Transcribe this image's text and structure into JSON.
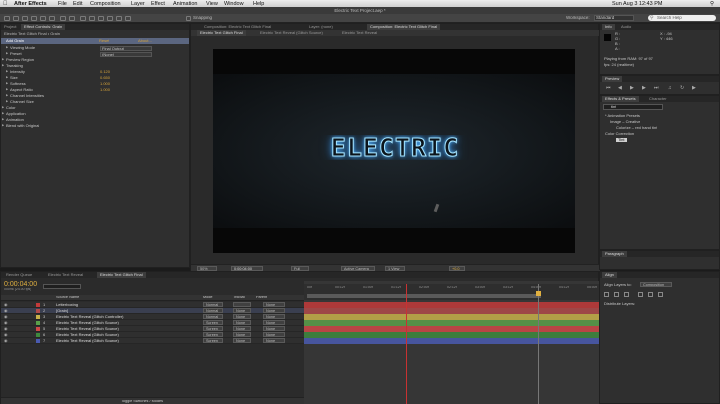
{
  "menubar": {
    "app": "After Effects",
    "items": [
      "File",
      "Edit",
      "Composition",
      "Layer",
      "Effect",
      "Animation",
      "View",
      "Window",
      "Help"
    ],
    "clock": "Sun Aug 3  12:43 PM"
  },
  "window_title": "Electric Text Project.aep *",
  "toolbar": {
    "snapping": "Snapping",
    "workspace_label": "Workspace:",
    "workspace_value": "Standard",
    "search_help": "Search Help"
  },
  "left_panel": {
    "tabs": [
      "Project",
      "Effect Controls: Grain"
    ],
    "header": "Electric Text Glitch Final • Grain",
    "effect_name": "Add Grain",
    "reset": "Reset",
    "about": "About...",
    "rows": [
      {
        "label": "Viewing Mode",
        "value": "Final Output"
      },
      {
        "label": "Preset",
        "value": "(None)"
      },
      {
        "label": "Preview Region",
        "value": ""
      },
      {
        "label": "Tweaking",
        "value": ""
      },
      {
        "label": "Intensity",
        "value": "0.120"
      },
      {
        "label": "Size",
        "value": "0.650"
      },
      {
        "label": "Softness",
        "value": "1.000"
      },
      {
        "label": "Aspect Ratio",
        "value": "1.000"
      },
      {
        "label": "Channel Intensities",
        "value": ""
      },
      {
        "label": "Channel Size",
        "value": ""
      },
      {
        "label": "Color",
        "value": ""
      },
      {
        "label": "Application",
        "value": ""
      },
      {
        "label": "Animation",
        "value": ""
      },
      {
        "label": "Blend with Original",
        "value": ""
      }
    ]
  },
  "comp_panel": {
    "tabs": [
      "Composition: Electric Text Glitch Final",
      "Layer: (none)",
      "Composition: Electric Text Glitch Final"
    ],
    "subtabs": [
      "Electric Text Glitch Final",
      "Electric Text Reveal (Glitch Source)",
      "Electric Text Reveal"
    ],
    "viewer_text": "ELECTRIC",
    "footer": {
      "zoom": "50%",
      "timecode": "0:00:04:00",
      "resolution": "Full",
      "camera": "Active Camera",
      "views": "1 View",
      "exposure": "+0.0"
    }
  },
  "right_panel": {
    "info_tab": "Info",
    "audio_tab": "Audio",
    "info": {
      "r": "R :",
      "g": "G :",
      "b": "B :",
      "a": "A :",
      "x": "X : -94",
      "y": "Y : 446"
    },
    "playing": "Playing from RAM: 97 of 97",
    "fps": "fps: 24 (realtime)",
    "preview_tab": "Preview",
    "effects_tab": "Effects & Presets",
    "character_tab": "Character",
    "search": "tint",
    "tree": [
      "* Animation Presets",
      "Image – Creative",
      "Colorize – red hand tint",
      "Color Correction",
      "Tint"
    ],
    "paragraph_tab": "Paragraph",
    "align_tab": "Align",
    "align_to_label": "Align Layers to:",
    "align_to_value": "Composition",
    "distribute": "Distribute Layers:"
  },
  "timeline": {
    "tabs": [
      "Render Queue",
      "Electric Text Reveal",
      "Electric Text Glitch Final"
    ],
    "timecode": "0:00:04:00",
    "frames": "00096 (24.00 fps)",
    "columns": {
      "source": "Source Name",
      "mode": "Mode",
      "trkmat": "TrkMat",
      "parent": "Parent"
    },
    "layers": [
      {
        "num": "1",
        "name": "Letterboxing",
        "mode": "Normal",
        "trk": "",
        "parent": "None",
        "color": "#c23a3a"
      },
      {
        "num": "2",
        "name": "[Grain]",
        "mode": "Normal",
        "trk": "None",
        "parent": "None",
        "color": "#b04a4a"
      },
      {
        "num": "3",
        "name": "Electric Text Reveal (Glitch Controller)",
        "mode": "Normal",
        "trk": "None",
        "parent": "None",
        "color": "#c8b24a"
      },
      {
        "num": "4",
        "name": "Electric Text Reveal (Glitch Source)",
        "mode": "Screen",
        "trk": "None",
        "parent": "None",
        "color": "#5aa04a"
      },
      {
        "num": "5",
        "name": "Electric Text Reveal (Glitch Source)",
        "mode": "Screen",
        "trk": "None",
        "parent": "None",
        "color": "#d04848"
      },
      {
        "num": "6",
        "name": "Electric Text Reveal (Glitch Source)",
        "mode": "Screen",
        "trk": "None",
        "parent": "None",
        "color": "#3e8a3e"
      },
      {
        "num": "7",
        "name": "Electric Text Reveal (Glitch Source)",
        "mode": "Screen",
        "trk": "None",
        "parent": "None",
        "color": "#4a5ab0"
      }
    ],
    "ruler": [
      "00f",
      "00:12f",
      "01:00f",
      "01:12f",
      "02:00f",
      "02:12f",
      "03:00f",
      "03:12f",
      "04:00f",
      "04:12f",
      "05:00f"
    ],
    "toggle": "Toggle Switches / Modes"
  },
  "colors": {
    "bg": "#1b1b1b",
    "panel": "#2f2f2f",
    "accent": "#d4a23a",
    "playhead": "#c83232",
    "electric": "#8fd8ff"
  }
}
